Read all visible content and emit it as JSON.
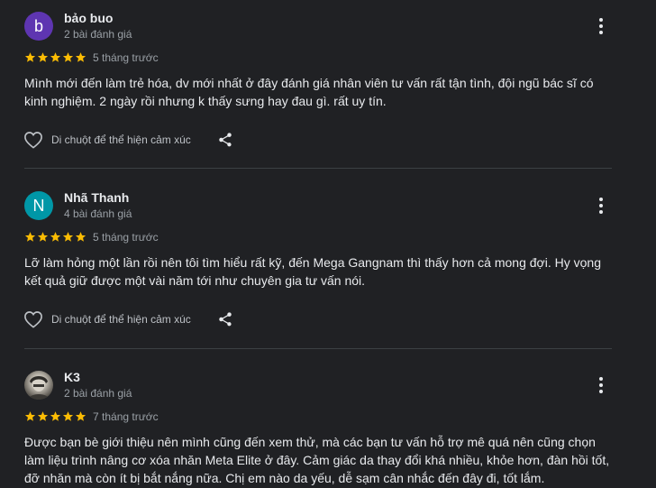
{
  "reviews": [
    {
      "name": "bảo buo",
      "avatar_letter": "b",
      "avatar_color": "#5e35b1",
      "review_count": "2 bài đánh giá",
      "rating": 5,
      "time": "5 tháng trước",
      "text": "Mình mới đến làm trẻ hóa, dv mới nhất ở đây đánh giá nhân viên tư vấn rất tận tình, đội ngũ bác sĩ có kinh nghiệm. 2 ngày rồi nhưng k thấy sưng hay đau gì. rất uy tín.",
      "like_label": "Di chuột để thể hiện cảm xúc"
    },
    {
      "name": "Nhã Thanh",
      "avatar_letter": "N",
      "avatar_color": "#0097a7",
      "review_count": "4 bài đánh giá",
      "rating": 5,
      "time": "5 tháng trước",
      "text": "Lỡ làm hỏng một lần rồi nên tôi tìm hiểu rất kỹ, đến Mega Gangnam thì thấy hơn cả mong đợi. Hy vọng kết quả giữ được một vài năm tới như chuyên gia tư vấn nói.",
      "like_label": "Di chuột để thể hiện cảm xúc"
    },
    {
      "name": "K3",
      "avatar_letter": "",
      "avatar_color": "",
      "review_count": "2 bài đánh giá",
      "rating": 5,
      "time": "7 tháng trước",
      "text": "Được bạn bè giới thiệu nên mình cũng đến xem thử, mà các bạn tư vấn hỗ trợ mê quá nên cũng chọn làm liệu trình nâng cơ xóa nhăn Meta Elite ở đây. Cảm giác da thay đổi khá nhiều, khỏe hơn, đàn hồi tốt, đỡ nhăn mà còn ít bị bắt nắng nữa. Chị em nào da yếu, dễ sạm cân nhắc đến đây đi, tốt lắm."
    }
  ],
  "colors": {
    "background": "#202124",
    "star": "#fbbc04",
    "text": "#e8eaed",
    "muted": "#9aa0a6",
    "divider": "#3c4043"
  },
  "icons": {
    "more": "more-vert-icon",
    "like": "heart-outline-icon",
    "share": "share-icon",
    "star": "star-icon"
  }
}
